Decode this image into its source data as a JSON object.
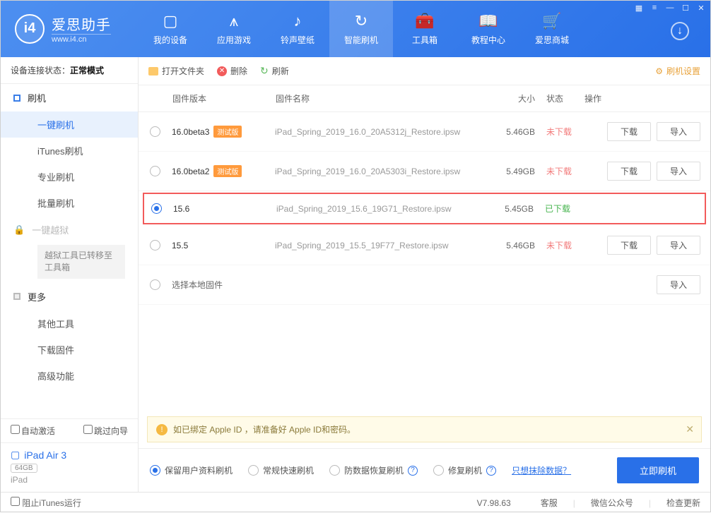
{
  "app": {
    "name_cn": "爱思助手",
    "name_en": "www.i4.cn"
  },
  "nav": {
    "items": [
      {
        "label": "我的设备"
      },
      {
        "label": "应用游戏"
      },
      {
        "label": "铃声壁纸"
      },
      {
        "label": "智能刷机"
      },
      {
        "label": "工具箱"
      },
      {
        "label": "教程中心"
      },
      {
        "label": "爱思商城"
      }
    ]
  },
  "sidebar": {
    "conn_label": "设备连接状态：",
    "conn_value": "正常模式",
    "groups": {
      "flash": "刷机",
      "jailbreak": "一键越狱",
      "more": "更多"
    },
    "flash_items": [
      "一键刷机",
      "iTunes刷机",
      "专业刷机",
      "批量刷机"
    ],
    "jb_note": "越狱工具已转移至工具箱",
    "more_items": [
      "其他工具",
      "下载固件",
      "高级功能"
    ],
    "auto_activate": "自动激活",
    "skip_guide": "跳过向导",
    "device_name": "iPad Air 3",
    "device_storage": "64GB",
    "device_type": "iPad"
  },
  "toolbar": {
    "open_folder": "打开文件夹",
    "delete": "删除",
    "refresh": "刷新",
    "settings": "刷机设置"
  },
  "table": {
    "headers": {
      "version": "固件版本",
      "name": "固件名称",
      "size": "大小",
      "status": "状态",
      "ops": "操作"
    },
    "btn_download": "下载",
    "btn_import": "导入",
    "beta_tag": "测试版",
    "local_firmware": "选择本地固件",
    "status_not": "未下载",
    "status_done": "已下载",
    "rows": [
      {
        "version": "16.0beta3",
        "beta": true,
        "name": "iPad_Spring_2019_16.0_20A5312j_Restore.ipsw",
        "size": "5.46GB",
        "status": "not",
        "selected": false
      },
      {
        "version": "16.0beta2",
        "beta": true,
        "name": "iPad_Spring_2019_16.0_20A5303i_Restore.ipsw",
        "size": "5.49GB",
        "status": "not",
        "selected": false
      },
      {
        "version": "15.6",
        "beta": false,
        "name": "iPad_Spring_2019_15.6_19G71_Restore.ipsw",
        "size": "5.45GB",
        "status": "done",
        "selected": true
      },
      {
        "version": "15.5",
        "beta": false,
        "name": "iPad_Spring_2019_15.5_19F77_Restore.ipsw",
        "size": "5.46GB",
        "status": "not",
        "selected": false
      }
    ]
  },
  "notice": "如已绑定 Apple ID ，请准备好 Apple ID和密码。",
  "options": {
    "keep_data": "保留用户资料刷机",
    "normal": "常规快速刷机",
    "anti_recovery": "防数据恢复刷机",
    "repair": "修复刷机",
    "erase_link": "只想抹除数据？",
    "flash_now": "立即刷机"
  },
  "statusbar": {
    "block_itunes": "阻止iTunes运行",
    "version": "V7.98.63",
    "service": "客服",
    "wechat": "微信公众号",
    "check_update": "检查更新"
  }
}
